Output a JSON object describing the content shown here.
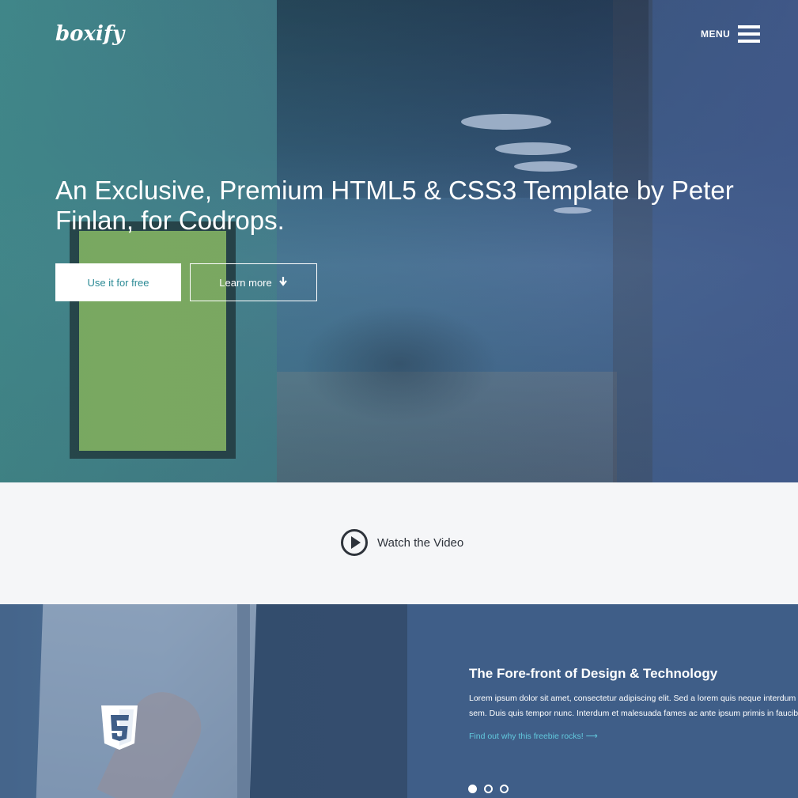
{
  "header": {
    "logo": "boxify",
    "menu_label": "MENU"
  },
  "hero": {
    "title": "An Exclusive, Premium HTML5 & CSS3 Template by Peter Finlan, for Codrops.",
    "primary_button": "Use it for free",
    "secondary_button": "Learn more",
    "secondary_icon": "arrow-down-icon"
  },
  "video": {
    "label": "Watch the Video",
    "icon": "play-icon"
  },
  "feature": {
    "icon": "html5-icon",
    "title": "The Fore-front of Design & Technology",
    "body_line1": "Lorem ipsum dolor sit amet, consectetur adipiscing elit. Sed a lorem quis neque interdum consequat ut sed",
    "body_line2": "sem. Duis quis tempor nunc. Interdum et malesuada fames ac ante ipsum primis in faucibus.",
    "link": "Find out why this freebie rocks! ⟶",
    "slides": 3,
    "active_slide": 1
  },
  "colors": {
    "accent_teal": "#2b8a95",
    "panel_blue": "#3f5e88",
    "link_cyan": "#62c8dd",
    "dark_text": "#2e333b"
  }
}
